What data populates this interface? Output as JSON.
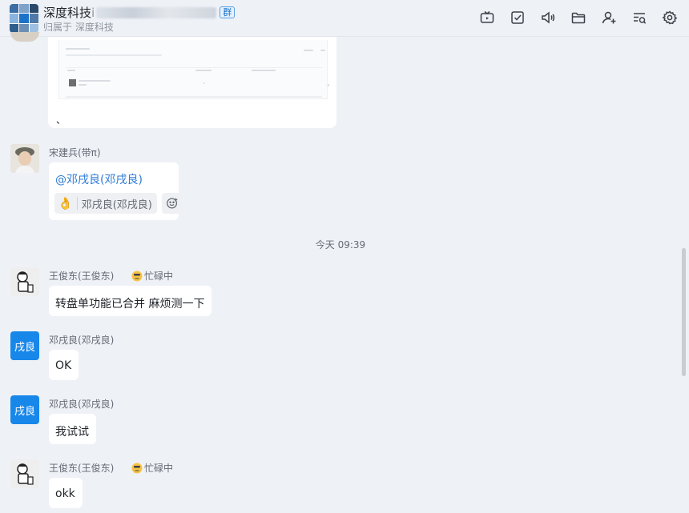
{
  "header": {
    "title": "深度科技",
    "title_partial": "i",
    "tag": "群",
    "subtitle": "归属于 深度科技",
    "icons": [
      "tv-icon",
      "checkbox-icon",
      "speaker-icon",
      "folder-icon",
      "add-member-icon",
      "search-list-icon",
      "settings-icon"
    ]
  },
  "messages": [
    {
      "id": "m1",
      "type": "image",
      "trailing_text": "、"
    },
    {
      "id": "m2",
      "sender": "宋建兵(带π)",
      "mention": "@邓戌良(邓戌良)",
      "reaction": {
        "emoji": "👌",
        "users": "邓戌良(邓戌良)"
      }
    },
    {
      "id": "m3",
      "sender": "王俊东(王俊东)",
      "status": "忙碌中",
      "text": "转盘单功能已合并 麻烦测一下"
    },
    {
      "id": "m4",
      "sender": "邓戌良(邓戌良)",
      "avatar_text": "戌良",
      "text": "OK"
    },
    {
      "id": "m5",
      "sender": "邓戌良(邓戌良)",
      "avatar_text": "戌良",
      "text": "我试试"
    },
    {
      "id": "m6",
      "sender": "王俊东(王俊东)",
      "status": "忙碌中",
      "text": "okk"
    }
  ],
  "time_divider": "今天 09:39",
  "colors": {
    "background": "#eef1f6",
    "bubble": "#ffffff",
    "accent": "#1887ea",
    "mention": "#2d7bd5"
  }
}
